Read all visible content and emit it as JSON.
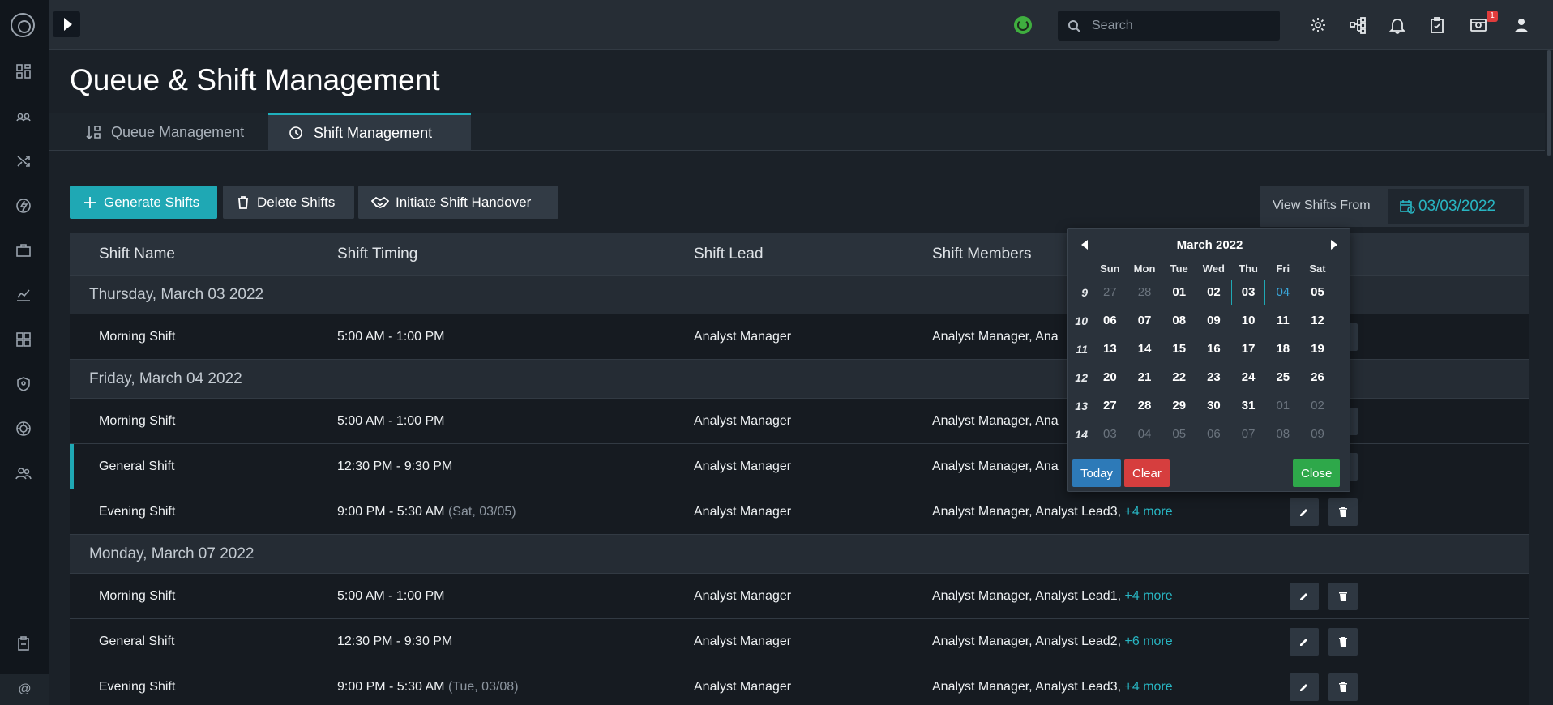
{
  "topbar": {
    "search_placeholder": "Search",
    "notification_count": "1"
  },
  "page": {
    "title": "Queue & Shift Management",
    "tabs": [
      {
        "label": "Queue Management",
        "icon": "queue-sort-icon"
      },
      {
        "label": "Shift Management",
        "icon": "history-clock-icon",
        "active": true
      }
    ]
  },
  "toolbar": {
    "generate": "Generate Shifts",
    "delete": "Delete Shifts",
    "handover": "Initiate Shift Handover",
    "view_from_label": "View Shifts From",
    "view_from_date": "03/03/2022"
  },
  "table": {
    "headers": [
      "Shift Name",
      "Shift Timing",
      "Shift Lead",
      "Shift Members"
    ],
    "groups": [
      {
        "date": "Thursday, March 03 2022",
        "rows": [
          {
            "name": "Morning Shift",
            "timing": "5:00 AM - 1:00 PM",
            "timing_note": "",
            "lead": "Analyst Manager",
            "members": "Analyst Manager, Ana",
            "more": ""
          }
        ]
      },
      {
        "date": "Friday, March 04 2022",
        "rows": [
          {
            "name": "Morning Shift",
            "timing": "5:00 AM - 1:00 PM",
            "timing_note": "",
            "lead": "Analyst Manager",
            "members": "Analyst Manager, Ana",
            "more": ""
          },
          {
            "name": "General Shift",
            "timing": "12:30 PM - 9:30 PM",
            "timing_note": "",
            "lead": "Analyst Manager",
            "members": "Analyst Manager, Ana",
            "more": ""
          },
          {
            "name": "Evening Shift",
            "timing": "9:00 PM - 5:30 AM",
            "timing_note": "(Sat, 03/05)",
            "lead": "Analyst Manager",
            "members": "Analyst Manager, Analyst Lead3,",
            "more": "+4 more"
          }
        ]
      },
      {
        "date": "Monday, March 07 2022",
        "rows": [
          {
            "name": "Morning Shift",
            "timing": "5:00 AM - 1:00 PM",
            "timing_note": "",
            "lead": "Analyst Manager",
            "members": "Analyst Manager, Analyst Lead1,",
            "more": "+4 more"
          },
          {
            "name": "General Shift",
            "timing": "12:30 PM - 9:30 PM",
            "timing_note": "",
            "lead": "Analyst Manager",
            "members": "Analyst Manager, Analyst Lead2,",
            "more": "+6 more"
          },
          {
            "name": "Evening Shift",
            "timing": "9:00 PM - 5:30 AM",
            "timing_note": "(Tue, 03/08)",
            "lead": "Analyst Manager",
            "members": "Analyst Manager, Analyst Lead3,",
            "more": "+4 more"
          }
        ]
      }
    ]
  },
  "datepicker": {
    "month": "March 2022",
    "weekdays": [
      "Sun",
      "Mon",
      "Tue",
      "Wed",
      "Thu",
      "Fri",
      "Sat"
    ],
    "weeks": [
      {
        "num": "9",
        "days": [
          "27",
          "28",
          "01",
          "02",
          "03",
          "04",
          "05"
        ]
      },
      {
        "num": "10",
        "days": [
          "06",
          "07",
          "08",
          "09",
          "10",
          "11",
          "12"
        ]
      },
      {
        "num": "11",
        "days": [
          "13",
          "14",
          "15",
          "16",
          "17",
          "18",
          "19"
        ]
      },
      {
        "num": "12",
        "days": [
          "20",
          "21",
          "22",
          "23",
          "24",
          "25",
          "26"
        ]
      },
      {
        "num": "13",
        "days": [
          "27",
          "28",
          "29",
          "30",
          "31",
          "01",
          "02"
        ]
      },
      {
        "num": "14",
        "days": [
          "03",
          "04",
          "05",
          "06",
          "07",
          "08",
          "09"
        ]
      }
    ],
    "today_label": "Today",
    "clear_label": "Clear",
    "close_label": "Close",
    "selected_color": "#1fa8b4",
    "today_color": "#3aa8dc"
  },
  "colors": {
    "accent": "#1fa8b4",
    "danger": "#d63e3e",
    "success": "#2ea84a"
  }
}
